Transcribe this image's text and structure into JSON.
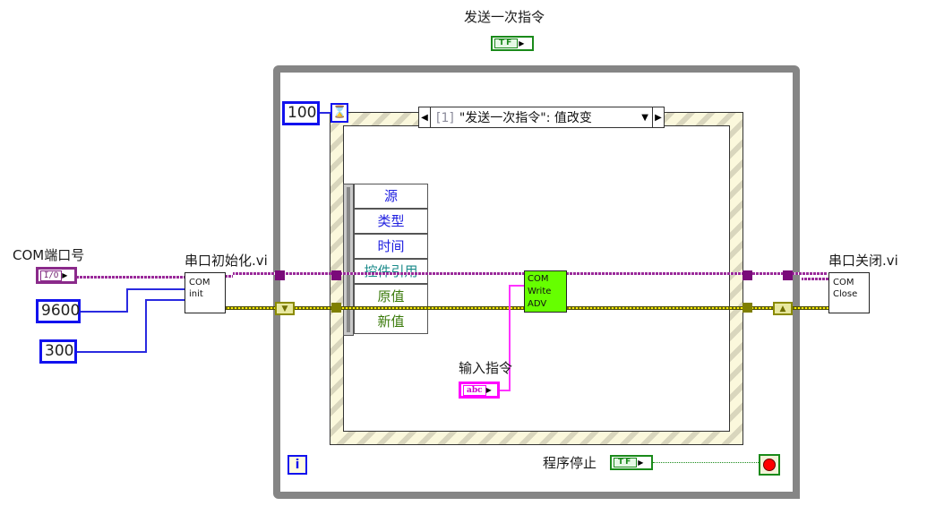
{
  "top_control": {
    "label": "发送一次指令",
    "indicator": "TF"
  },
  "while_loop": {
    "timeout_value": "100",
    "timeout_icon": "hourglass-icon",
    "iteration_terminal": "i",
    "stop": {
      "label": "程序停止",
      "indicator": "TF",
      "stop_icon": "stop-sign-icon"
    }
  },
  "event_structure": {
    "case_index": "[1]",
    "case_label": "\"发送一次指令\": 值改变",
    "event_data_node": [
      {
        "label": "源",
        "color": "#2020e0"
      },
      {
        "label": "类型",
        "color": "#2020e0"
      },
      {
        "label": "时间",
        "color": "#2020e0"
      },
      {
        "label": "控件引用",
        "color": "#1a8a8a"
      },
      {
        "label": "原值",
        "color": "#3a7a0a"
      },
      {
        "label": "新值",
        "color": "#3a7a0a"
      }
    ],
    "write_vi": {
      "lines": [
        "COM",
        "Write",
        "ADV"
      ],
      "color": "#66ff00"
    },
    "input_control": {
      "label": "输入指令",
      "indicator": "abc"
    }
  },
  "left": {
    "com_port": {
      "label": "COM端口号",
      "indicator": "I/O"
    },
    "baud_rate": "9600",
    "timeout": "300",
    "init_vi": {
      "label": "串口初始化.vi",
      "lines": [
        "COM",
        "init"
      ]
    }
  },
  "right": {
    "close_vi": {
      "label": "串口关闭.vi",
      "lines": [
        "COM",
        "Close"
      ]
    }
  }
}
